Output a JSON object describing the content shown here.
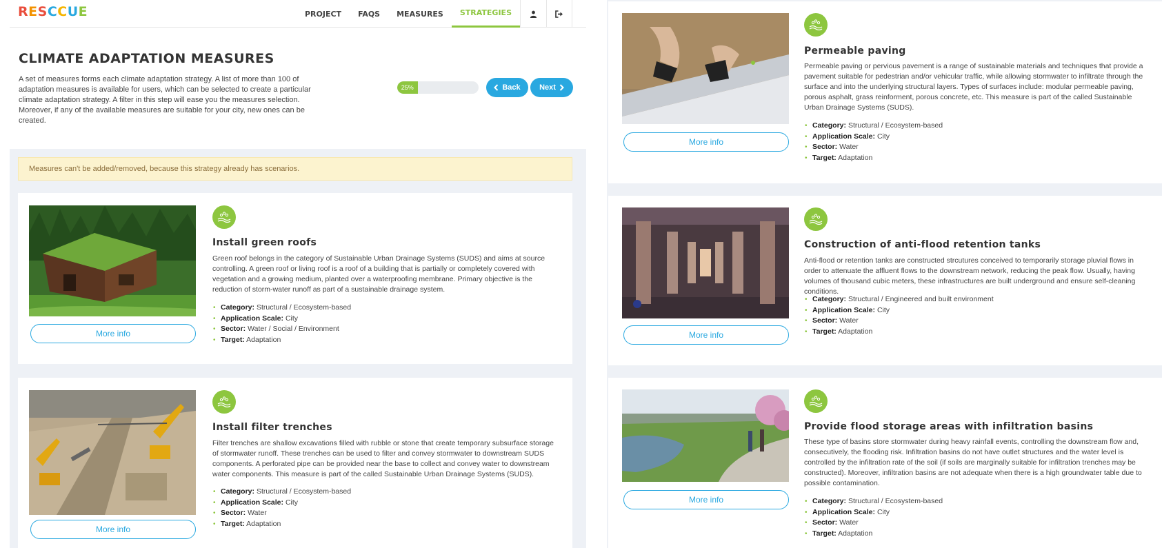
{
  "app": {
    "logo_letters": [
      {
        "ch": "R",
        "color": "#e94e3d"
      },
      {
        "ch": "E",
        "color": "#f39200"
      },
      {
        "ch": "S",
        "color": "#e94e3d"
      },
      {
        "ch": "C",
        "color": "#29a8e0"
      },
      {
        "ch": "C",
        "color": "#f5b400"
      },
      {
        "ch": "U",
        "color": "#29a8e0"
      },
      {
        "ch": "E",
        "color": "#8dc63f"
      }
    ]
  },
  "nav": {
    "items": [
      "PROJECT",
      "FAQS",
      "MEASURES",
      "STRATEGIES"
    ],
    "active": "STRATEGIES",
    "icons": [
      "user-icon",
      "sign-out-icon"
    ]
  },
  "page": {
    "title": "CLIMATE ADAPTATION MEASURES",
    "description": "A set of measures forms each climate adaptation strategy. A list of more than 100 of adaptation measures is available for users, which can be selected to create a particular climate adaptation strategy. A filter in this step will ease you the measures selection. Moreover, if any of the available measures are suitable for your city, new ones can be created.",
    "progress_label": "25%",
    "progress_fraction": 0.25,
    "back_label": "Back",
    "next_label": "Next",
    "warning": "Measures can't be added/removed, because this strategy already has scenarios."
  },
  "labels": {
    "category": "Category:",
    "scale": "Application Scale:",
    "sector": "Sector:",
    "target": "Target:",
    "more_info": "More info"
  },
  "colors": {
    "accent_green": "#8dc63f",
    "accent_blue": "#29a8e0",
    "warning_bg": "#fcf3cf"
  },
  "measures_left": [
    {
      "title": "Install green roofs",
      "description": "Green roof belongs in the category of Sustainable Urban Drainage Systems (SUDS) and aims at source controlling. A green roof or living roof is a roof of a building that is partially or completely covered with vegetation and a growing medium, planted over a waterproofing membrane. Primary objective is the reduction of storm-water runoff as part of a sustainable drainage system.",
      "category": "Structural / Ecosystem-based",
      "scale": "City",
      "sector": "Water / Social / Environment",
      "target": "Adaptation"
    },
    {
      "title": "Install filter trenches",
      "description": "Filter trenches are shallow excavations filled with rubble or stone that create temporary subsurface storage of stormwater runoff. These trenches can be used to filter and convey stormwater to downstream SUDS components. A perforated pipe can be provided near the base to collect and convey water to downstream water components. This measure is part of the called Sustainable Urban Drainage Systems (SUDS).",
      "category": "Structural / Ecosystem-based",
      "scale": "City",
      "sector": "Water",
      "target": "Adaptation"
    }
  ],
  "measures_right": [
    {
      "title": "Permeable paving",
      "description": "Permeable paving or pervious pavement is a range of sustainable materials and techniques that provide a pavement suitable for pedestrian and/or vehicular traffic, while allowing stormwater to infiltrate through the surface and into the underlying structural layers. Types of surfaces include: modular permeable paving, porous asphalt, grass reinforment, porous concrete, etc. This measure is part of the called Sustainable Urban Drainage Systems (SUDS).",
      "category": "Structural / Ecosystem-based",
      "scale": "City",
      "sector": "Water",
      "target": "Adaptation"
    },
    {
      "title": "Construction of anti-flood retention tanks",
      "description": "Anti-flood or retention tanks are constructed strcutures conceived to temporarily storage pluvial flows in order to attenuate the affluent flows to the downstream network, reducing the peak flow. Usually, having volumes of thousand cubic meters, these infrastructures are built underground and ensure self-cleaning conditions.",
      "category": "Structural / Engineered and built environment",
      "scale": "City",
      "sector": "Water",
      "target": "Adaptation"
    },
    {
      "title": "Provide flood storage areas with infiltration basins",
      "description": "These type of basins store stormwater during heavy rainfall events, controlling the downstream flow and, consecutively, the flooding risk. Infiltration basins do not have outlet structures and the water level is controlled by the infiltration rate of the soil (if soils are marginally suitable for infiltration trenches may be constructed). Moreover, infiltration basins are not adequate when there is a high groundwater table due to possible contamination.",
      "category": "Structural / Ecosystem-based",
      "scale": "City",
      "sector": "Water",
      "target": "Adaptation"
    }
  ]
}
